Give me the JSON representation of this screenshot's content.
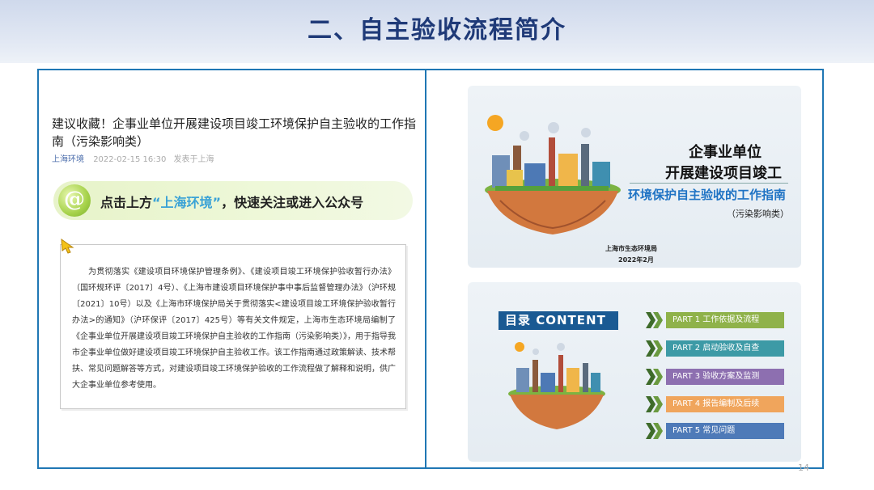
{
  "slide": {
    "title": "二、自主验收流程简介",
    "page_number": "14"
  },
  "article": {
    "title": "建议收藏！企事业单位开展建设项目竣工环境保护自主验收的工作指南（污染影响类）",
    "source": "上海环境",
    "date": "2022-02-15 16:30",
    "location": "发表于上海",
    "banner": {
      "logo_glyph": "@",
      "prefix": "点击上方",
      "highlight": "“上海环境”",
      "suffix": "，快速关注或进入公众号"
    },
    "notice_text": "为贯彻落实《建设项目环境保护管理条例》、《建设项目竣工环境保护验收暂行办法》（国环规环评〔2017〕4号）、《上海市建设项目环境保护事中事后监督管理办法》（沪环规〔2021〕10号）以及《上海市环境保护局关于贯彻落实<建设项目竣工环境保护验收暂行办法>的通知》（沪环保评〔2017〕425号）等有关文件规定，上海市生态环境局编制了《企事业单位开展建设项目竣工环境保护自主验收的工作指南（污染影响类）》，用于指导我市企事业单位做好建设项目竣工环境保护自主验收工作。该工作指南通过政策解读、技术帮扶、常见问题解答等方式，对建设项目竣工环境保护验收的工作流程做了解释和说明，供广大企事业单位参考使用。"
  },
  "cover": {
    "line1": "企事业单位",
    "line2": "开展建设项目竣工",
    "line3": "环境保护自主验收的工作指南",
    "line4": "（污染影响类）",
    "org": "上海市生态环境局",
    "date": "2022年2月"
  },
  "toc": {
    "heading": "目录 CONTENT",
    "items": [
      {
        "label": "PART 1  工作依据及流程",
        "color": "#8fb24a"
      },
      {
        "label": "PART 2  启动验收及自查",
        "color": "#3d9aa6"
      },
      {
        "label": "PART 3  验收方案及监测",
        "color": "#8d6fb0"
      },
      {
        "label": "PART 4  报告编制及后续",
        "color": "#f0a55c"
      },
      {
        "label": "PART 5  常见问题",
        "color": "#4e7ab8"
      }
    ]
  },
  "colors": {
    "title": "#1f3a78",
    "frame": "#1f77b4",
    "banner_highlight": "#3aa2d6",
    "guide_title": "#1f73c4",
    "toc_heading_bg": "#1a5a93"
  }
}
